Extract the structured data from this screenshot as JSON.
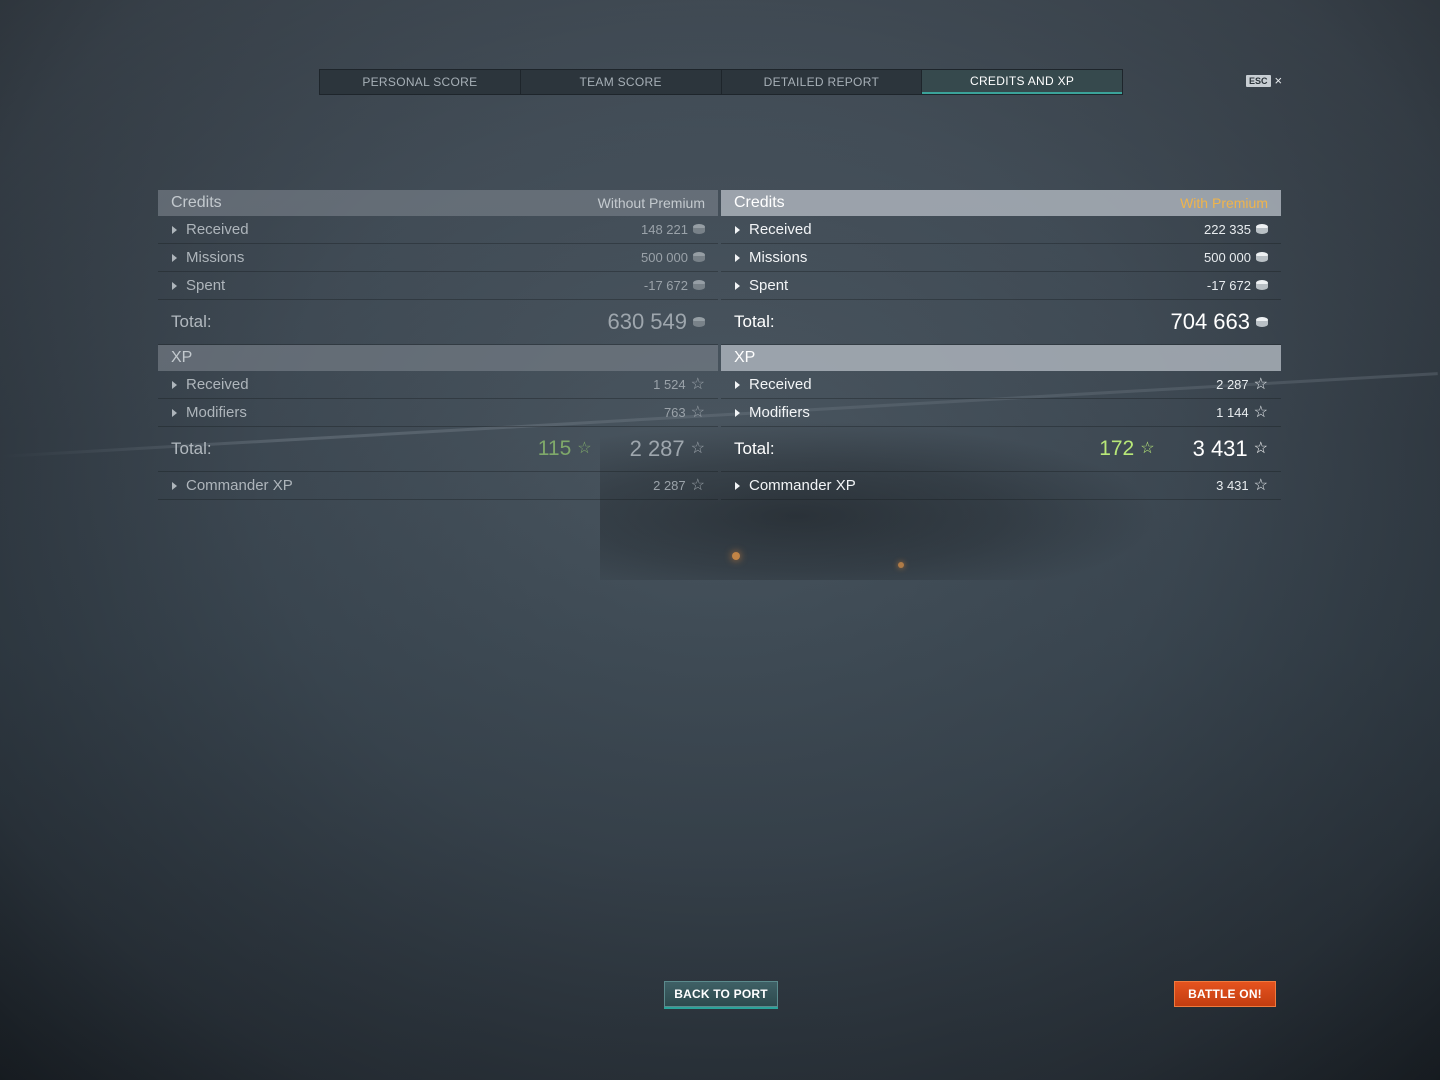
{
  "tabs": [
    {
      "label": "PERSONAL SCORE"
    },
    {
      "label": "TEAM SCORE"
    },
    {
      "label": "DETAILED REPORT"
    },
    {
      "label": "CREDITS AND XP",
      "active": true
    }
  ],
  "esc": {
    "key": "ESC",
    "close": "×"
  },
  "left": {
    "credits_title": "Credits",
    "mode_label": "Without Premium",
    "credits_rows": [
      {
        "label": "Received",
        "value": "148 221"
      },
      {
        "label": "Missions",
        "value": "500 000"
      },
      {
        "label": "Spent",
        "value": "-17 672"
      }
    ],
    "credits_total_label": "Total:",
    "credits_total": "630 549",
    "xp_title": "XP",
    "xp_rows": [
      {
        "label": "Received",
        "value": "1 524"
      },
      {
        "label": "Modifiers",
        "value": "763"
      }
    ],
    "xp_total_label": "Total:",
    "xp_bonus": "115",
    "xp_total": "2 287",
    "commander_label": "Commander XP",
    "commander_value": "2 287"
  },
  "right": {
    "credits_title": "Credits",
    "mode_label": "With Premium",
    "credits_rows": [
      {
        "label": "Received",
        "value": "222 335"
      },
      {
        "label": "Missions",
        "value": "500 000"
      },
      {
        "label": "Spent",
        "value": "-17 672"
      }
    ],
    "credits_total_label": "Total:",
    "credits_total": "704 663",
    "xp_title": "XP",
    "xp_rows": [
      {
        "label": "Received",
        "value": "2 287"
      },
      {
        "label": "Modifiers",
        "value": "1 144"
      }
    ],
    "xp_total_label": "Total:",
    "xp_bonus": "172",
    "xp_total": "3 431",
    "commander_label": "Commander XP",
    "commander_value": "3 431"
  },
  "buttons": {
    "back": "BACK TO PORT",
    "battle": "BATTLE ON!"
  },
  "icons": {
    "credits": "credit-coin-icon",
    "xp": "star-icon"
  },
  "colors": {
    "premium": "#f0b44a",
    "active_tab": "#3ba39a",
    "battle": "#d9481a"
  }
}
